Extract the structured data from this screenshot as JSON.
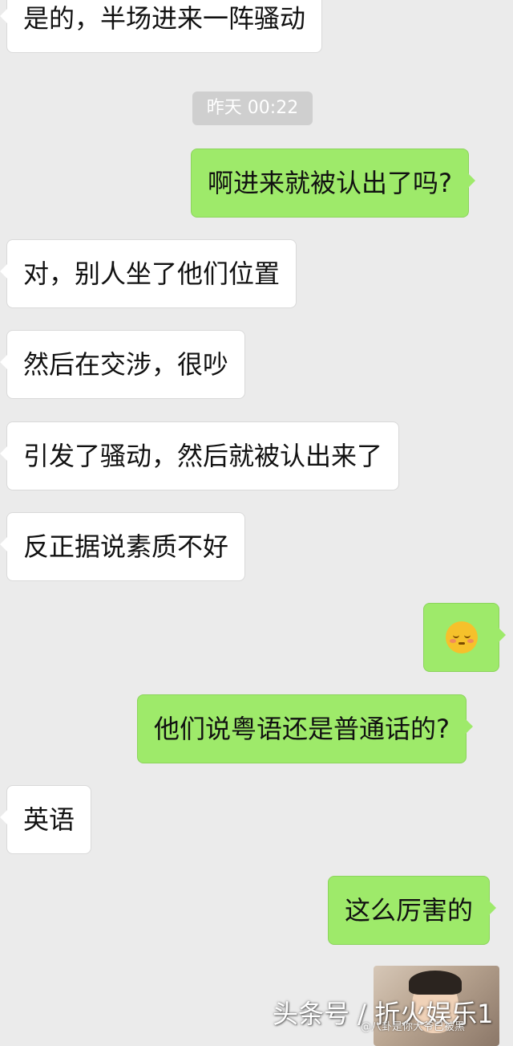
{
  "chat": {
    "timestamp": "昨天 00:22",
    "messages": [
      {
        "side": "left",
        "text": "是的，半场进来一阵骚动"
      },
      {
        "side": "right",
        "text": "啊进来就被认出了吗?"
      },
      {
        "side": "left",
        "text": "对，别人坐了他们位置"
      },
      {
        "side": "left",
        "text": "然后在交涉，很吵"
      },
      {
        "side": "left",
        "text": "引发了骚动，然后就被认出来了"
      },
      {
        "side": "left",
        "text": "反正据说素质不好"
      },
      {
        "side": "right",
        "emoji": "blushing-face-icon"
      },
      {
        "side": "right",
        "text": "他们说粤语还是普通话的?"
      },
      {
        "side": "left",
        "text": "英语"
      },
      {
        "side": "right",
        "text": "这么厉害的"
      }
    ]
  },
  "watermark": {
    "main": "头条号 / 折火娱乐1",
    "sub": "@八卦是你大爷已被黑"
  },
  "colors": {
    "background": "#ebebeb",
    "right_bubble": "#9eea6a",
    "left_bubble": "#ffffff",
    "timestamp_bg": "#cfcfcf"
  }
}
